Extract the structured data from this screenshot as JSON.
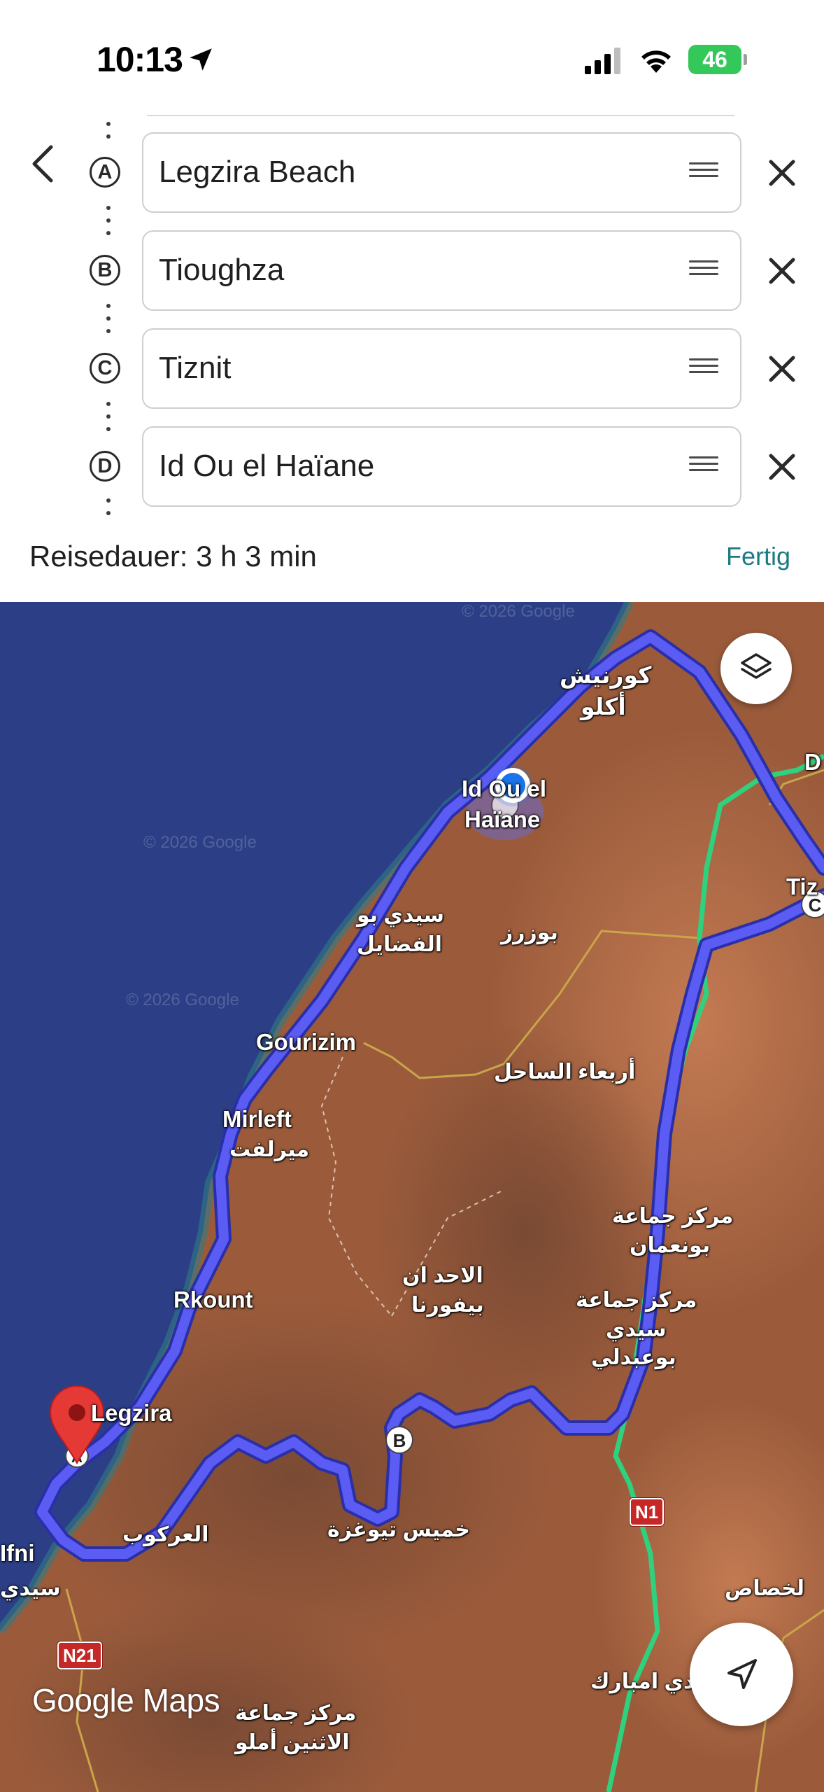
{
  "status_bar": {
    "time": "10:13",
    "battery": "46"
  },
  "route": {
    "stops": [
      {
        "badge": "A",
        "name": "Legzira Beach"
      },
      {
        "badge": "B",
        "name": "Tioughza"
      },
      {
        "badge": "C",
        "name": "Tiznit"
      },
      {
        "badge": "D",
        "name": "Id Ou el Haïane"
      }
    ],
    "duration": "Reisedauer: 3 h 3 min",
    "done_label": "Fertig"
  },
  "map": {
    "labels": {
      "corniche": "كورنيش",
      "aglou": "أكلو",
      "id_ou_el": "Id Ou el",
      "haiane": "Haïane",
      "sidi_bou_1": "سيدي بو",
      "sidi_bou_2": "الفضايل",
      "bouzrz": "بوزرز",
      "gourizim": "Gourizim",
      "arbaa_sahel": "أربعاء الساحل",
      "mirleft": "Mirleft",
      "mirleft_ar": "ميرلفت",
      "markaz_bounaaman_1": "مركز جماعة",
      "markaz_bounaaman_2": "بونعمان",
      "rkount": "Rkount",
      "ahad_1": "الاحد ان",
      "ahad_2": "بيفورنا",
      "markaz_sidi_1": "مركز جماعة",
      "markaz_sidi_2": "سيدي",
      "markaz_sidi_3": "بوعبدلي",
      "legzira": "Legzira",
      "aarkoub": "العركوب",
      "khmis": "خميس تيوغزة",
      "ifni": "Ifni",
      "sidi_left": "سيدي",
      "lakhsas": "لخصاص",
      "sidi_mbarek": "سيدي امبارك",
      "markaz_itnine_1": "مركز جماعة",
      "markaz_itnine_2": "الاثنين أملو",
      "tiznit_partial": "Tiz",
      "d_partial": "D"
    },
    "road_shields": {
      "n1": "N1",
      "n21": "N21"
    },
    "watermark": "© 2026 Google",
    "logo": "Google Maps",
    "colors": {
      "route": "#4a4df0",
      "alt_road": "#2fd17e",
      "sea": "#2c3f86",
      "pin": "#e53935",
      "location_dot": "#1a73e8"
    }
  }
}
